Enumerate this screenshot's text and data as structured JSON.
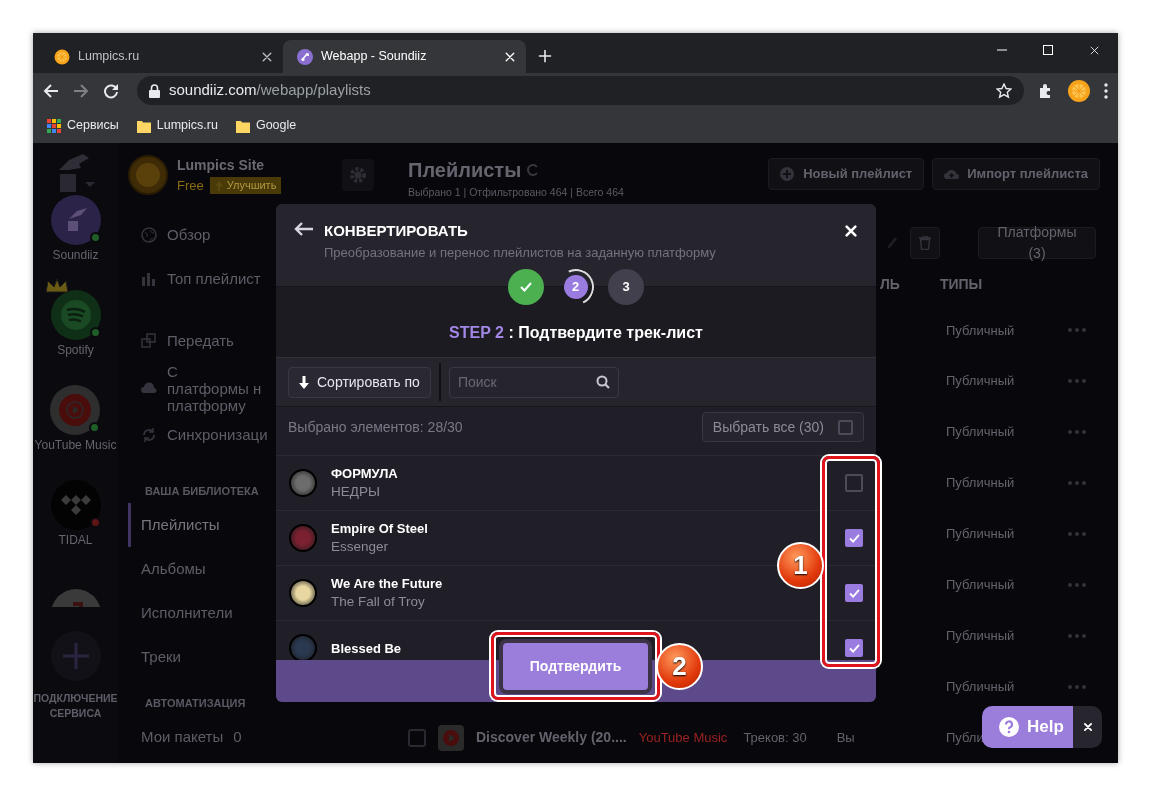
{
  "browser": {
    "tabs": [
      {
        "title": "Lumpics.ru",
        "kind": "orange",
        "selected": false
      },
      {
        "title": "Webapp - Soundiiz",
        "kind": "soundiiz",
        "selected": true
      }
    ],
    "address": {
      "host": "soundiiz.com",
      "path": "/webapp/playlists"
    },
    "bookmarks": [
      {
        "label": "Сервисы",
        "kind": "apps"
      },
      {
        "label": "Lumpics.ru",
        "kind": "folder"
      },
      {
        "label": "Google",
        "kind": "folder"
      }
    ]
  },
  "services": [
    {
      "name": "Soundiiz",
      "kind": "soundiiz",
      "connected": true,
      "premium": false
    },
    {
      "name": "Spotify",
      "kind": "spotify",
      "connected": true,
      "premium": true
    },
    {
      "name": "YouTube Music",
      "kind": "youtube",
      "connected": true,
      "premium": false
    },
    {
      "name": "TIDAL",
      "kind": "tidal",
      "connected": false,
      "premium": false
    },
    {
      "kind": "apple"
    }
  ],
  "add_service": {
    "label": "ПОДКЛЮЧЕНИЕ СЕРВИСА"
  },
  "account": {
    "name": "Lumpics Site",
    "plan": "Free",
    "upgrade": "Улучшить"
  },
  "nav": [
    {
      "label": "Обзор"
    },
    {
      "label": "Топ плейлист"
    },
    {
      "label": "Передать"
    },
    {
      "label": "С платформы н платформу"
    },
    {
      "label": "Синхронизаци"
    }
  ],
  "library": {
    "heading": "ВАША БИБЛИОТЕКА",
    "items": [
      {
        "label": "Плейлисты",
        "selected": true
      },
      {
        "label": "Альбомы",
        "selected": false
      },
      {
        "label": "Исполнители",
        "selected": false
      },
      {
        "label": "Треки",
        "selected": false
      }
    ]
  },
  "automation": {
    "heading": "АВТОМАТИЗАЦИЯ",
    "items": [
      {
        "label": "Мои пакеты",
        "count": "0"
      }
    ]
  },
  "main": {
    "title": "Плейлисты",
    "summary": "Выбрано 1 | Отфильтровано 464 | Всего 464",
    "actions": [
      "Новый плейлист",
      "Импорт плейлиста"
    ],
    "platforms_button": "Платформы (3)",
    "columns": [
      "ЛЬ",
      "ТИПЫ"
    ],
    "rows": [
      {
        "type": "Публичный"
      },
      {
        "type": "Публичный"
      },
      {
        "type": "Публичный"
      },
      {
        "type": "Публичный"
      },
      {
        "type": "Публичный"
      },
      {
        "type": "Публичный"
      },
      {
        "type": "Публичный"
      },
      {
        "type": "Публичный"
      },
      {
        "checked": false,
        "name": "Discover Weekly (20....",
        "platform": "YouTube Music",
        "tracks": "Треков: 30",
        "owner": "Вы",
        "type": "Публи"
      }
    ]
  },
  "modal": {
    "title": "КОНВЕРТИРОВАТЬ",
    "subtitle": "Преобразование и перенос плейлистов на заданную платформу",
    "steps": [
      {
        "kind": "done"
      },
      {
        "label": "2",
        "kind": "current"
      },
      {
        "label": "3",
        "kind": "pending"
      }
    ],
    "step_tag": "STEP 2",
    "step_text": ": Подтвердите трек-лист",
    "sort_button": "Сортировать по",
    "search": {
      "placeholder": "Поиск"
    },
    "selection_count": "Выбрано элементов: 28/30",
    "select_all": {
      "label": "Выбрать все (30)",
      "checked": false
    },
    "tracks": [
      {
        "title": "ФОРМУЛА",
        "artist": "НЕДРЫ",
        "checked": false
      },
      {
        "title": "Empire Of Steel",
        "artist": "Essenger",
        "checked": true
      },
      {
        "title": "We Are the Future",
        "artist": "The Fall of Troy",
        "checked": true
      },
      {
        "title": "Blessed Be",
        "checked": true
      }
    ],
    "confirm_button": "Подтвердить"
  },
  "annotations": [
    {
      "label": "1"
    },
    {
      "label": "2"
    }
  ],
  "help": {
    "label": "Help"
  }
}
